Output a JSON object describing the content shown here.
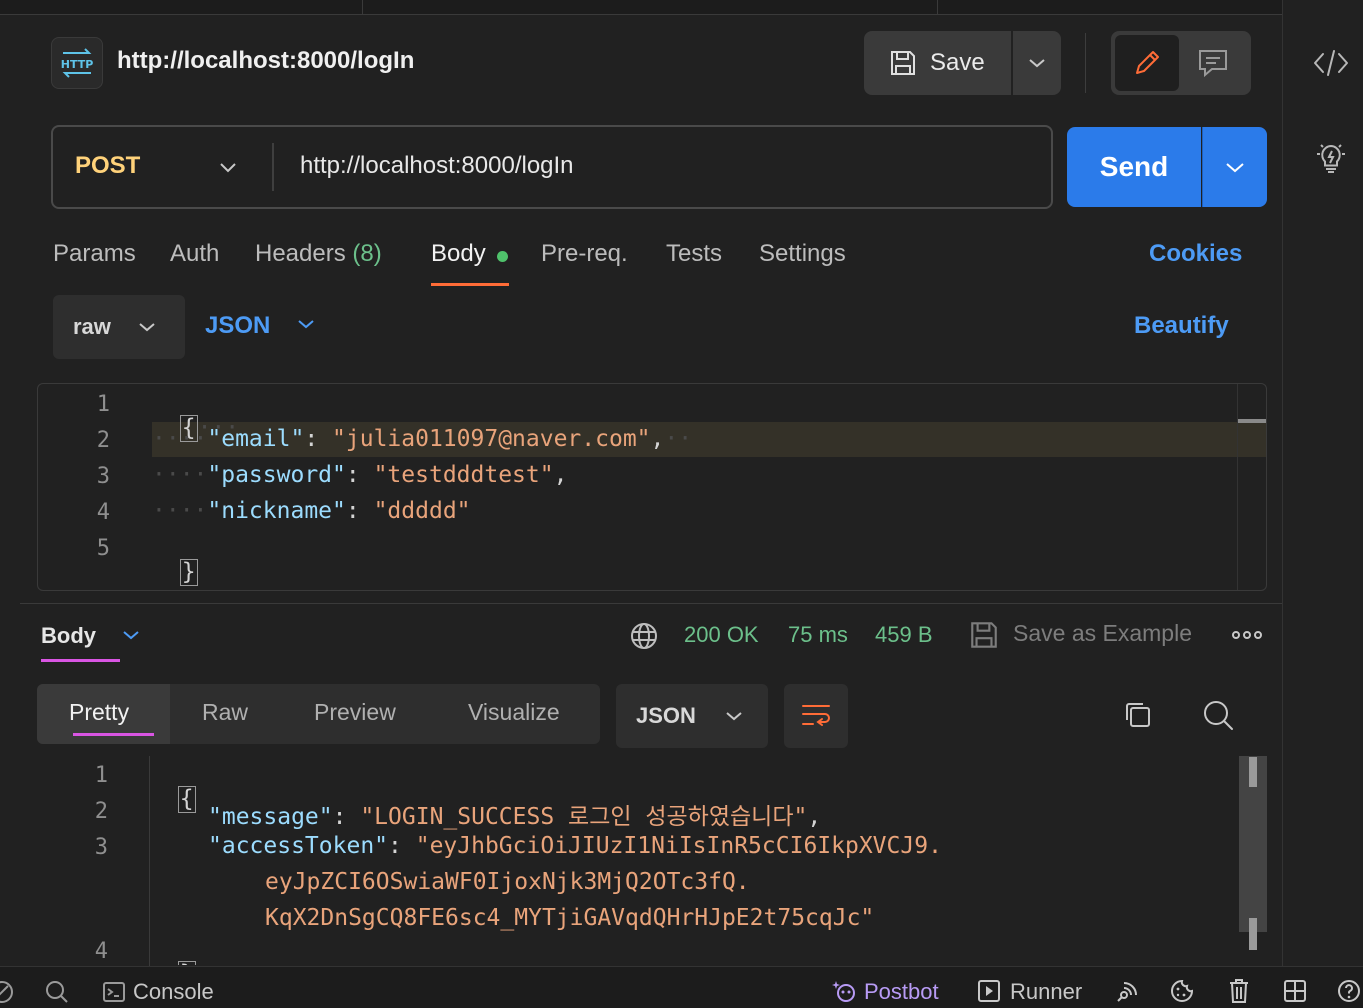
{
  "request": {
    "title": "http://localhost:8000/logIn",
    "icon": "http-icon",
    "save_label": "Save",
    "method": "POST",
    "url": "http://localhost:8000/logIn",
    "send_label": "Send"
  },
  "request_tabs": {
    "params": "Params",
    "auth": "Auth",
    "headers": "Headers",
    "headers_count": "(8)",
    "body": "Body",
    "prereq": "Pre-req.",
    "tests": "Tests",
    "settings": "Settings",
    "cookies": "Cookies"
  },
  "body_options": {
    "mode": "raw",
    "language": "JSON",
    "beautify": "Beautify"
  },
  "request_body": {
    "line_numbers": [
      "1",
      "2",
      "3",
      "4",
      "5"
    ],
    "open_brace": "{",
    "close_brace": "}",
    "fields": [
      {
        "key": "\"email\"",
        "value": "\"julia011097@naver.com\"",
        "trail": ","
      },
      {
        "key": "\"password\"",
        "value": "\"testdddtest\"",
        "trail": ","
      },
      {
        "key": "\"nickname\"",
        "value": "\"ddddd\"",
        "trail": ""
      }
    ]
  },
  "response": {
    "section_label": "Body",
    "status": "200 OK",
    "time": "75 ms",
    "size": "459 B",
    "save_example": "Save as Example",
    "more": "ooo",
    "tabs": [
      "Pretty",
      "Raw",
      "Preview",
      "Visualize"
    ],
    "format": "JSON",
    "line_numbers": [
      "1",
      "2",
      "3",
      "4"
    ],
    "open_brace": "{",
    "close_brace": "}",
    "message_key": "\"message\"",
    "message_value": "\"LOGIN_SUCCESS 로그인 성공하였습니다\"",
    "token_key": "\"accessToken\"",
    "token_line1": "\"eyJhbGciOiJIUzI1NiIsInR5cCI6IkpXVCJ9.",
    "token_line2": "eyJpZCI6OSwiaWF0IjoxNjk3MjQ2OTc3fQ.",
    "token_line3": "KqX2DnSgCQ8FE6sc4_MYTjiGAVqdQHrHJpE2t75cqJc\""
  },
  "statusbar": {
    "console": "Console",
    "postbot": "Postbot",
    "runner": "Runner"
  },
  "colors": {
    "accent": "#ff6c37",
    "send": "#2b7bea",
    "link": "#4d9bf5",
    "success": "#6cc08b",
    "method": "#ffd27a"
  }
}
